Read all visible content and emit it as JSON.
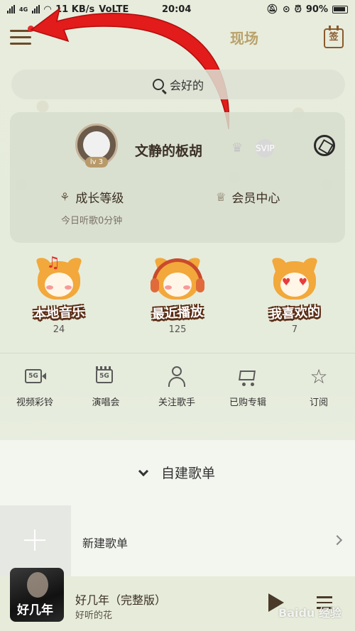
{
  "status_bar": {
    "network_label": "4G",
    "speed": "11 KB/s",
    "volte": "VoLTE",
    "time": "20:04",
    "battery": "90%"
  },
  "top_nav": {
    "tabs": [
      "现场"
    ],
    "checkin_label": "签"
  },
  "search": {
    "placeholder": "会好的"
  },
  "profile": {
    "username": "文静的板胡",
    "level": "lv 3",
    "svip_label": "SVIP",
    "growth_label": "成长等级",
    "vip_center_label": "会员中心",
    "listen_time": "今日听歌0分钟"
  },
  "mascots": [
    {
      "title": "本地音乐",
      "count": "24"
    },
    {
      "title": "最近播放",
      "count": "125"
    },
    {
      "title": "我喜欢的",
      "count": "7"
    }
  ],
  "quick_actions": [
    {
      "label": "视频彩铃",
      "icon": "video-ringtone-icon",
      "badge": "5G"
    },
    {
      "label": "演唱会",
      "icon": "concert-icon",
      "badge": "5G"
    },
    {
      "label": "关注歌手",
      "icon": "follow-singer-icon"
    },
    {
      "label": "已购专辑",
      "icon": "cart-icon"
    },
    {
      "label": "订阅",
      "icon": "star-icon"
    }
  ],
  "playlists": {
    "section_title": "自建歌单",
    "new_playlist_label": "新建歌单"
  },
  "player": {
    "album_text": "好几年",
    "track_title": "好几年（完整版）",
    "artist": "好听的花"
  },
  "watermark": "Baidu 经验",
  "colors": {
    "accent": "#8a5a2e",
    "annotation_arrow": "#e21b1b",
    "notification_dot": "#e82b2b"
  }
}
